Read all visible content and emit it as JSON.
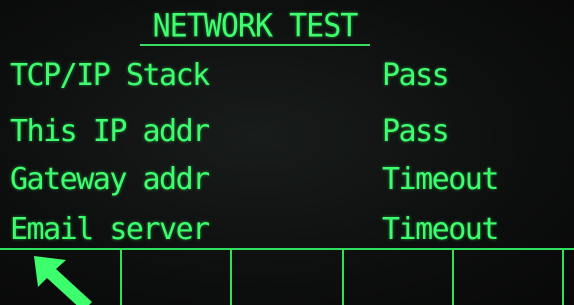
{
  "screen": {
    "title": "NETWORK TEST",
    "rows": [
      {
        "label": "TCP/IP Stack",
        "value": "Pass"
      },
      {
        "label": "This IP addr",
        "value": "Pass"
      },
      {
        "label": "Gateway addr",
        "value": "Timeout"
      },
      {
        "label": "Email server",
        "value": "Timeout"
      }
    ]
  },
  "softkeys": [
    {
      "icon": "exit-arrow-icon"
    },
    {
      "icon": ""
    },
    {
      "icon": ""
    },
    {
      "icon": ""
    },
    {
      "icon": ""
    },
    {
      "icon": ""
    }
  ],
  "colors": {
    "display_green": "#3dff6e",
    "background": "#0d0f0e"
  }
}
